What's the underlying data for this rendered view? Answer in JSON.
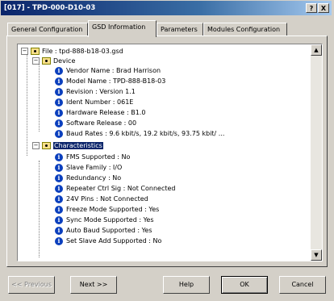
{
  "window": {
    "title": "[017] - TPD-000-D10-03",
    "help_glyph": "?",
    "close_glyph": "X"
  },
  "tabs": [
    {
      "label": "General Configuration"
    },
    {
      "label": "GSD Information"
    },
    {
      "label": "Parameters"
    },
    {
      "label": "Modules Configuration"
    }
  ],
  "tree": {
    "root_label": "File : tpd-888-b18-03.gsd",
    "expander_glyph": "−",
    "info_glyph": "i",
    "device": {
      "label": "Device",
      "items": [
        "Vendor Name : Brad Harrison",
        "Model Name : TPD-888-B18-03",
        "Revision : Version 1.1",
        "Ident Number : 061E",
        "Hardware Release : B1.0",
        "Software Release : 00",
        "Baud Rates : 9.6 kbit/s, 19.2 kbit/s, 93.75 kbit/ ..."
      ]
    },
    "characteristics": {
      "label": "Characteristics",
      "items": [
        "FMS Supported : No",
        "Slave Family : I/O",
        "Redundancy : No",
        "Repeater Ctrl Sig : Not Connected",
        "24V Pins : Not Connected",
        "Freeze Mode Supported : Yes",
        "Sync Mode Supported : Yes",
        "Auto Baud Supported : Yes",
        "Set Slave Add Supported : No"
      ]
    },
    "scroll_up_glyph": "▲",
    "scroll_down_glyph": "▼"
  },
  "buttons": {
    "previous": "<< Previous",
    "next": "Next >>",
    "help": "Help",
    "ok": "OK",
    "cancel": "Cancel"
  }
}
